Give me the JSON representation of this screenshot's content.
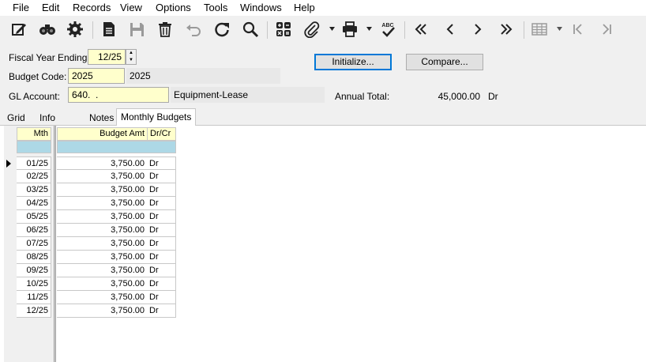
{
  "menu": [
    "File",
    "Edit",
    "Records",
    "View",
    "Options",
    "Tools",
    "Windows",
    "Help"
  ],
  "toolbar": {
    "icons": [
      "edit-icon",
      "find-icon",
      "settings-icon",
      "document-icon",
      "save-icon",
      "delete-icon",
      "undo-icon",
      "refresh-icon",
      "search-icon",
      "calculator-icon",
      "attach-icon",
      "print-icon",
      "spellcheck-icon",
      "first-record-icon",
      "previous-record-icon",
      "next-record-icon",
      "last-record-icon",
      "grid-view-icon",
      "first-page-icon",
      "last-page-icon"
    ],
    "spellcheck_text": "ABC"
  },
  "form": {
    "fiscal_year_label": "Fiscal Year Ending:",
    "fiscal_year_value": "12/25",
    "budget_code_label": "Budget Code:",
    "budget_code_value": "2025",
    "budget_code_desc": "2025",
    "gl_account_label": "GL Account:",
    "gl_account_value": "640.  .",
    "gl_account_desc": "Equipment-Lease",
    "annual_total_label": "Annual Total:",
    "annual_total_value": "45,000.00",
    "annual_total_drcr": "Dr",
    "initialize_label": "Initialize...",
    "compare_label": "Compare..."
  },
  "tabs": [
    "Grid",
    "Info",
    "Notes",
    "Monthly Budgets"
  ],
  "active_tab": "Monthly Budgets",
  "grid": {
    "columns": {
      "mth": "Mth",
      "budget_amt": "Budget Amt",
      "drcr": "Dr/Cr"
    },
    "rows": [
      {
        "mth": "01/25",
        "amt": "3,750.00",
        "drcr": "Dr"
      },
      {
        "mth": "02/25",
        "amt": "3,750.00",
        "drcr": "Dr"
      },
      {
        "mth": "03/25",
        "amt": "3,750.00",
        "drcr": "Dr"
      },
      {
        "mth": "04/25",
        "amt": "3,750.00",
        "drcr": "Dr"
      },
      {
        "mth": "05/25",
        "amt": "3,750.00",
        "drcr": "Dr"
      },
      {
        "mth": "06/25",
        "amt": "3,750.00",
        "drcr": "Dr"
      },
      {
        "mth": "07/25",
        "amt": "3,750.00",
        "drcr": "Dr"
      },
      {
        "mth": "08/25",
        "amt": "3,750.00",
        "drcr": "Dr"
      },
      {
        "mth": "09/25",
        "amt": "3,750.00",
        "drcr": "Dr"
      },
      {
        "mth": "10/25",
        "amt": "3,750.00",
        "drcr": "Dr"
      },
      {
        "mth": "11/25",
        "amt": "3,750.00",
        "drcr": "Dr"
      },
      {
        "mth": "12/25",
        "amt": "3,750.00",
        "drcr": "Dr"
      }
    ]
  },
  "colors": {
    "field_yellow": "#ffffcc",
    "filter_blue": "#add8e6",
    "focus_blue": "#0078d7"
  }
}
